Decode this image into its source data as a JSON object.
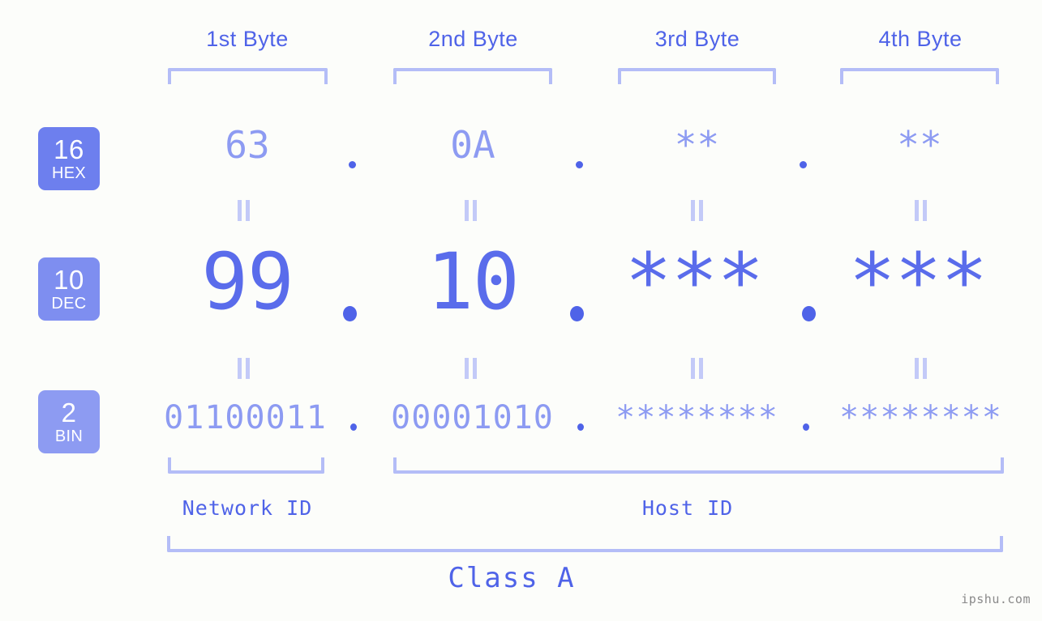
{
  "page": {
    "background_color": "#fcfdfa",
    "accent_color": "#4f63e8",
    "light_accent_color": "#b4bdf7",
    "mid_accent_color": "#8d9bf2"
  },
  "byte_headers": [
    {
      "label": "1st Byte"
    },
    {
      "label": "2nd Byte"
    },
    {
      "label": "3rd Byte"
    },
    {
      "label": "4th Byte"
    }
  ],
  "rows": [
    {
      "badge": {
        "number": "16",
        "name": "HEX",
        "color": "#6d7fee"
      },
      "values": [
        "63",
        "0A",
        "**",
        "**"
      ],
      "separators": [
        ".",
        ".",
        "."
      ]
    },
    {
      "badge": {
        "number": "10",
        "name": "DEC",
        "color": "#7e8ef0"
      },
      "values": [
        "99",
        "10",
        "***",
        "***"
      ],
      "separators": [
        ".",
        ".",
        "."
      ]
    },
    {
      "badge": {
        "number": "2",
        "name": "BIN",
        "color": "#8d9bf2"
      },
      "values": [
        "01100011",
        "00001010",
        "********",
        "********"
      ],
      "separators": [
        ".",
        ".",
        "."
      ]
    }
  ],
  "equals_marks": [
    {
      "label": "="
    },
    {
      "label": "="
    },
    {
      "label": "="
    },
    {
      "label": "="
    },
    {
      "label": "="
    },
    {
      "label": "="
    },
    {
      "label": "="
    },
    {
      "label": "="
    }
  ],
  "sections": [
    {
      "label": "Network ID"
    },
    {
      "label": "Host ID"
    }
  ],
  "class": {
    "label": "Class A"
  },
  "watermark": {
    "text": "ipshu.com"
  }
}
